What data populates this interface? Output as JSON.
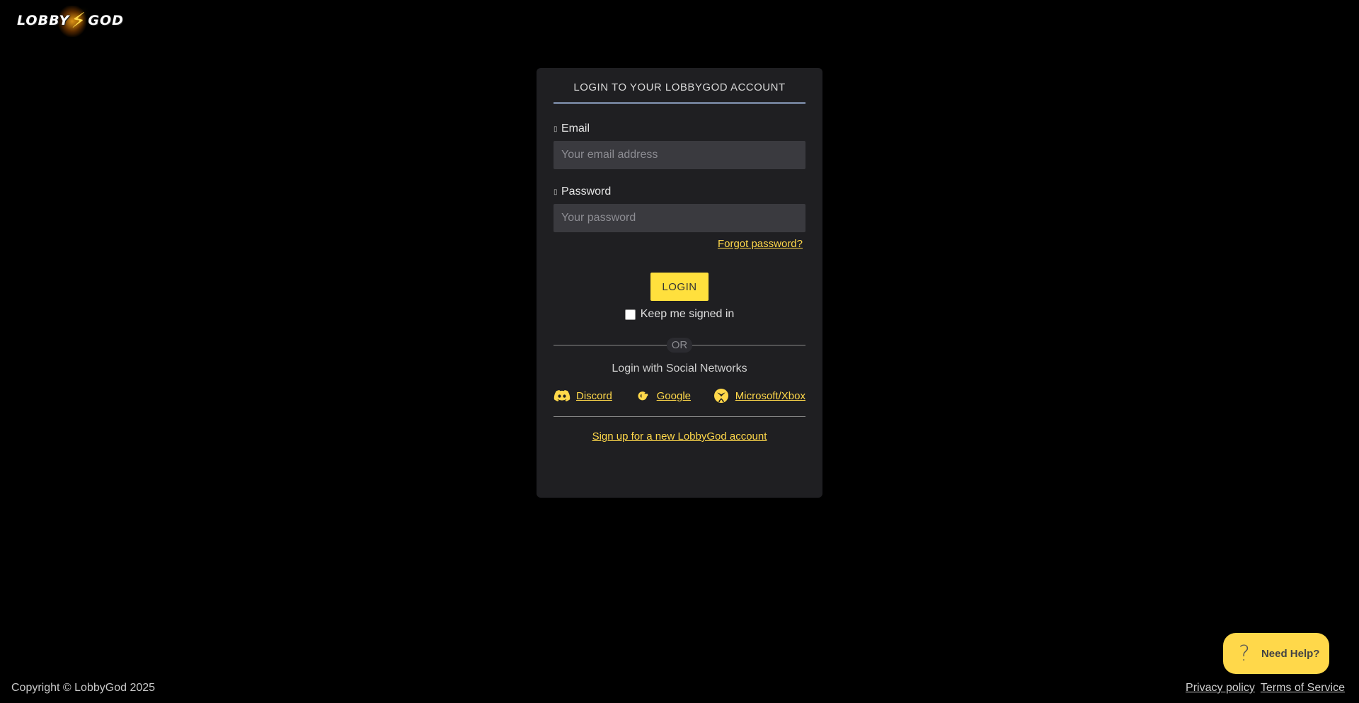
{
  "brand": {
    "logo_left": "LOBBY",
    "logo_right": "GOD"
  },
  "login_card": {
    "title": "LOGIN TO YOUR LOBBYGOD ACCOUNT",
    "email_label": "Email",
    "email_placeholder": "Your email address",
    "email_value": "",
    "password_label": "Password",
    "password_placeholder": "Your password",
    "password_value": "",
    "forgot_link": "Forgot password?",
    "login_button": "LOGIN",
    "keep_signed_in_label": "Keep me signed in",
    "keep_signed_in_checked": false,
    "or_text": "OR",
    "social_title": "Login with Social Networks",
    "social": [
      {
        "label": "Discord",
        "icon": "discord-icon"
      },
      {
        "label": "Google",
        "icon": "google-icon"
      },
      {
        "label": "Microsoft/Xbox",
        "icon": "xbox-icon"
      }
    ],
    "signup_link": "Sign up for a new LobbyGod account"
  },
  "footer": {
    "copyright": "Copyright © LobbyGod 2025",
    "privacy": "Privacy policy",
    "terms": "Terms of Service"
  },
  "help": {
    "label": "Need Help?"
  },
  "colors": {
    "accent": "#ffd84a",
    "card_bg": "#1f1f22",
    "input_bg": "#3a3a3f",
    "title_rule": "#6f7d96",
    "page_bg": "#000000"
  }
}
